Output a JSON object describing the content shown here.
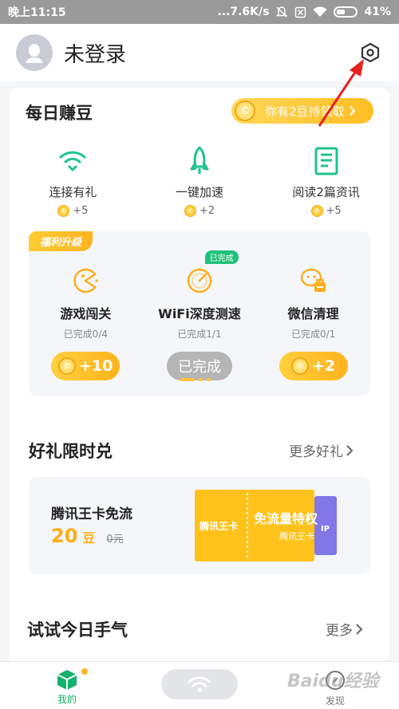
{
  "status_bar": {
    "time": "晚上11:15",
    "network_speed": "...7.6K/s",
    "battery": "41%"
  },
  "header": {
    "user_name": "未登录"
  },
  "daily": {
    "title": "每日赚豆",
    "claim_label": "你有2豆待领取",
    "tasks": [
      {
        "label": "连接有礼",
        "reward": "+5",
        "icon": "wifi-icon"
      },
      {
        "label": "一键加速",
        "reward": "+2",
        "icon": "rocket-icon"
      },
      {
        "label": "阅读2篇资讯",
        "reward": "+5",
        "icon": "article-icon"
      }
    ],
    "bonus": {
      "tag": "福利升级",
      "items": [
        {
          "name": "游戏闯关",
          "progress": "已完成0/4",
          "button": "+10",
          "icon": "pacman-icon"
        },
        {
          "name": "WiFi深度测速",
          "progress": "已完成1/1",
          "button": "已完成",
          "badge": "已完成",
          "icon": "speedometer-icon"
        },
        {
          "name": "微信清理",
          "progress": "已完成0/1",
          "button": "+2",
          "icon": "wechat-clean-icon"
        }
      ]
    }
  },
  "gifts": {
    "title": "好礼限时兑",
    "more_label": "更多好礼",
    "item": {
      "name": "腾讯王卡免流",
      "price": "20",
      "unit": "豆",
      "original": "0元",
      "ticket_brand": "腾讯王卡",
      "ticket_title": "免流量特权",
      "ticket_sub": "腾讯王卡",
      "ticket_side": "IP"
    }
  },
  "luck": {
    "title": "试试今日手气",
    "more_label": "更多"
  },
  "bottom_nav": {
    "mine_label": "我的",
    "find_label": "发现"
  },
  "watermark": "Baidu经验",
  "colors": {
    "brand_green": "#14b26b",
    "gold": "#ffb321",
    "arrow_red": "#e8201f"
  }
}
